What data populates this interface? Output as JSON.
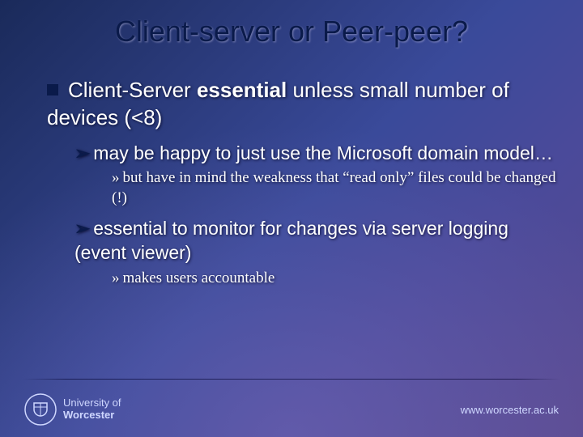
{
  "slide": {
    "title": "Client-server or Peer-peer?",
    "bullet1_a": "Client-Server ",
    "bullet1_b": "essential",
    "bullet1_c": " unless small number of devices (<8)",
    "sub1": "may be happy to just use the Microsoft domain model…",
    "sub1_a": "but have in mind the weakness that “read only” files could be changed (!)",
    "sub2": "essential to monitor for changes via server logging (event viewer)",
    "sub2_a": "makes users accountable"
  },
  "footer": {
    "logo_line1": "University of",
    "logo_line2": "Worcester",
    "url": "www.worcester.ac.uk"
  }
}
